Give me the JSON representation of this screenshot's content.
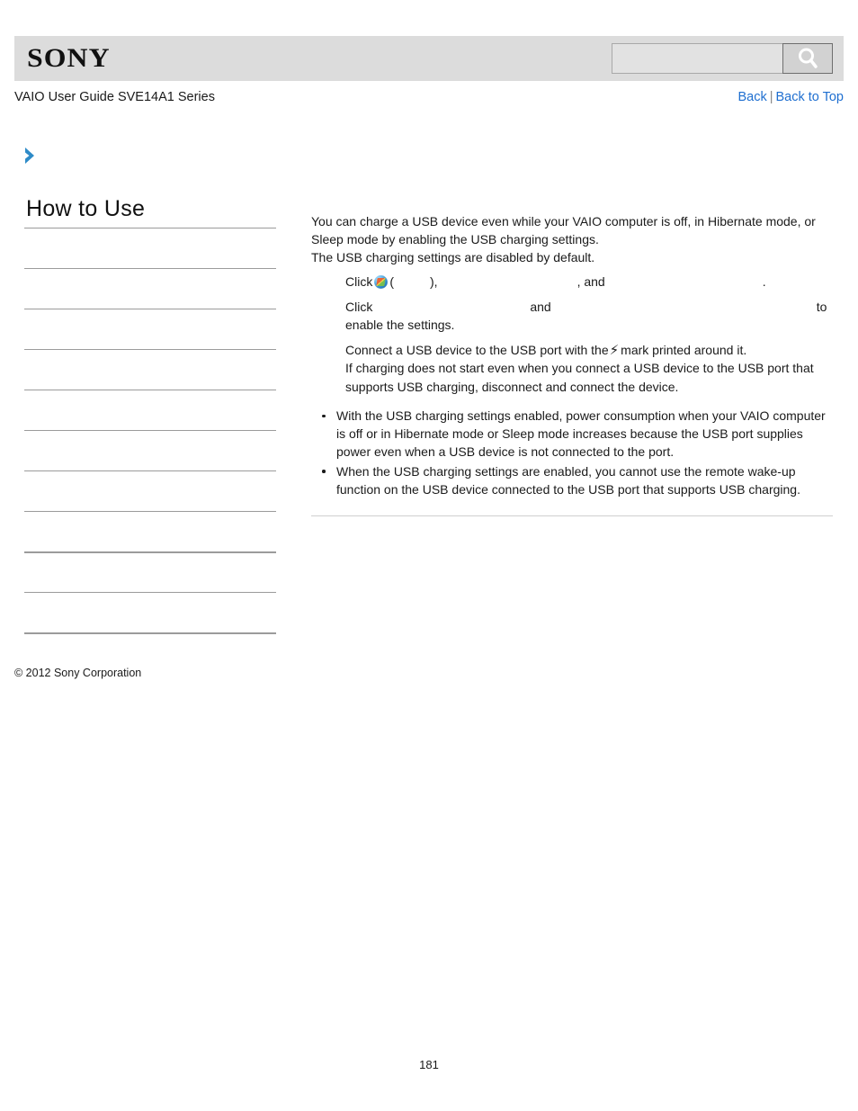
{
  "header": {
    "logo": "SONY",
    "search": {
      "value": "",
      "placeholder": "",
      "icon": "search-icon"
    }
  },
  "subheader": {
    "guide_title": "VAIO User Guide SVE14A1 Series",
    "back_label": "Back",
    "separator": "|",
    "back_to_top_label": "Back to Top"
  },
  "sidebar": {
    "chevron_icon": "chevron-right-icon",
    "title": "How to Use",
    "rows": [
      {
        "label": ""
      },
      {
        "label": ""
      },
      {
        "label": ""
      },
      {
        "label": ""
      },
      {
        "label": ""
      },
      {
        "label": ""
      },
      {
        "label": ""
      },
      {
        "label": ""
      },
      {
        "label": ""
      },
      {
        "label": ""
      },
      {
        "label": ""
      }
    ],
    "copyright": "© 2012 Sony Corporation"
  },
  "content": {
    "intro": [
      "You can charge a USB device even while your VAIO computer is off, in Hibernate mode, or Sleep mode by enabling the USB charging settings.",
      "The USB charging settings are disabled by default."
    ],
    "steps": [
      {
        "prefix": "Click",
        "icon": "windows-start-orb-icon",
        "open_paren": "(",
        "close_paren": "),",
        "middle": ", and",
        "suffix": "."
      },
      {
        "prefix": "Click",
        "middle": "and",
        "suffix": "to enable the settings."
      },
      {
        "text_before_bolt": "Connect a USB device to the USB port with the",
        "bolt_icon": "lightning-bolt-icon",
        "text_after_bolt": "mark printed around it."
      },
      {
        "text": "If charging does not start even when you connect a USB device to the USB port that supports USB charging, disconnect and connect the device."
      }
    ],
    "notes": [
      "With the USB charging settings enabled, power consumption when your VAIO computer is off or in Hibernate mode or Sleep mode increases because the USB port supplies power even when a USB device is not connected to the port.",
      "When the USB charging settings are enabled, you cannot use the remote wake-up function on the USB device connected to the USB port that supports USB charging."
    ]
  },
  "footer": {
    "page_number": "181"
  },
  "colors": {
    "header_band": "#dcdcdc",
    "link": "#1f6fd0",
    "chevron": "#2e8bc8",
    "divider": "#9b9b9b"
  }
}
